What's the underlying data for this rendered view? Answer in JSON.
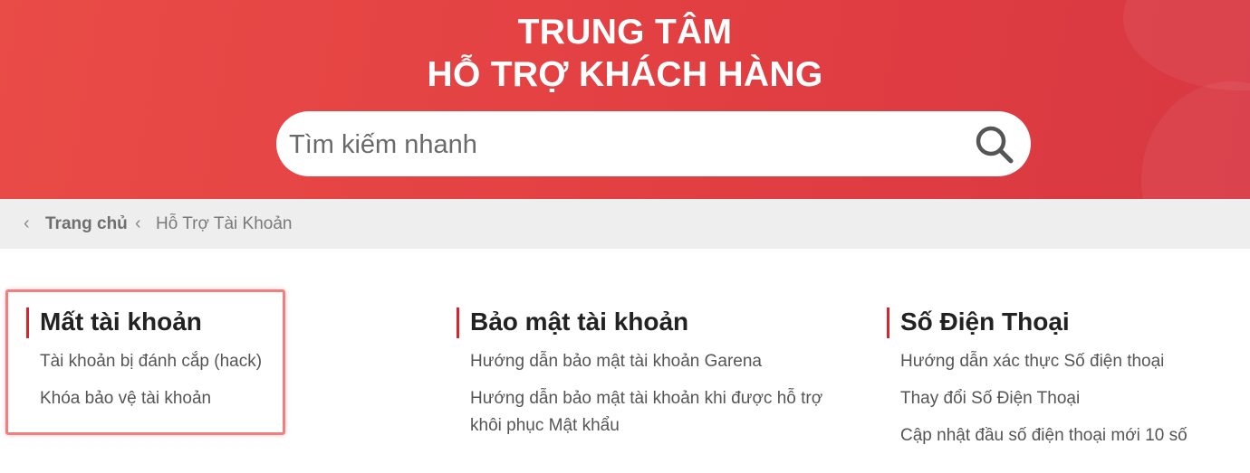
{
  "header": {
    "title_line1": "TRUNG TÂM",
    "title_line2": "HỖ TRỢ KHÁCH HÀNG",
    "accent_color": "#e4434a"
  },
  "search": {
    "placeholder": "Tìm kiếm nhanh",
    "icon": "search-icon"
  },
  "breadcrumb": {
    "home_label": "Trang chủ",
    "current_label": "Hỗ Trợ Tài Khoản",
    "separator_icon": "chevron-left-icon"
  },
  "categories": [
    {
      "title": "Mất tài khoản",
      "links": [
        "Tài khoản bị đánh cắp (hack)",
        "Khóa bảo vệ tài khoản"
      ]
    },
    {
      "title": "Bảo mật tài khoản",
      "links": [
        "Hướng dẫn bảo mật tài khoản Garena",
        "Hướng dẫn bảo mật tài khoản khi được hỗ trợ khôi phục Mật khẩu"
      ]
    },
    {
      "title": "Số Điện Thoại",
      "links": [
        "Hướng dẫn xác thực Số điện thoại",
        "Thay đổi Số Điện Thoại",
        "Cập nhật đầu số điện thoại mới 10 số"
      ]
    }
  ],
  "colors": {
    "title_bar": "#d8242c",
    "highlight_border": "#f08080",
    "breadcrumb_bg": "#eeeeee"
  }
}
